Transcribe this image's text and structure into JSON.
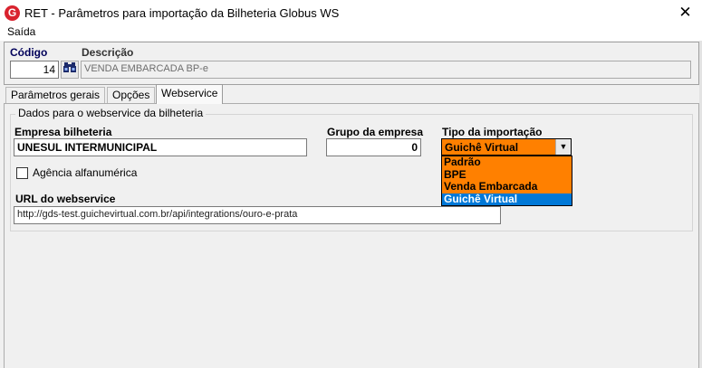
{
  "window": {
    "icon_letter": "G",
    "title": "RET - Parâmetros para importação da Bilheteria Globus WS",
    "close_label": "✕"
  },
  "menu": {
    "items": [
      "Saída"
    ]
  },
  "header": {
    "code_label": "Código",
    "code_value": "14",
    "desc_label": "Descrição",
    "desc_value": "VENDA EMBARCADA BP-e"
  },
  "tabs": [
    {
      "label": "Parâmetros gerais",
      "active": false
    },
    {
      "label": "Opções",
      "active": false
    },
    {
      "label": "Webservice",
      "active": true
    }
  ],
  "webservice": {
    "group_title": "Dados para o webservice da bilheteria",
    "empresa_label": "Empresa bilheteria",
    "empresa_value": "UNESUL INTERMUNICIPAL",
    "grupo_label": "Grupo da empresa",
    "grupo_value": "0",
    "tipo_label": "Tipo da importação",
    "tipo_value": "Guichê Virtual",
    "tipo_options": [
      "Padrão",
      "BPE",
      "Venda Embarcada",
      "Guichê Virtual"
    ],
    "agencia_label": "Agência alfanumérica",
    "agencia_checked": false,
    "url_label": "URL do webservice",
    "url_value": "http://gds-test.guichevirtual.com.br/api/integrations/ouro-e-prata"
  },
  "colors": {
    "combo_bg": "#ff8000",
    "selected_item": "#0078d7",
    "label_navy": "#00005a",
    "app_icon": "#d9232e"
  },
  "icons": [
    "app-logo-icon",
    "close-icon",
    "binoculars-icon",
    "dropdown-arrow-icon"
  ]
}
